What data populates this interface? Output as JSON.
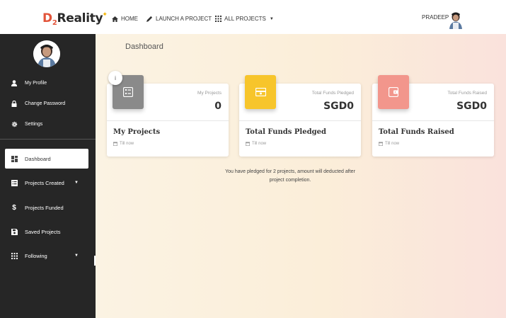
{
  "brand": {
    "logo_d": "D",
    "logo_sub": "2",
    "logo_rest": "Reality",
    "accent": "#e2543a"
  },
  "nav": {
    "home": "HOME",
    "launch": "LAUNCH A PROJECT",
    "all_projects": "ALL PROJECTS",
    "user": "PRADEEP"
  },
  "sidebar": {
    "profile_items": [
      {
        "label": "My Profile",
        "icon": "user-icon"
      },
      {
        "label": "Change Password",
        "icon": "lock-icon"
      },
      {
        "label": "Settings",
        "icon": "gear-icon"
      }
    ],
    "menu_items": [
      {
        "label": "Dashboard",
        "icon": "dashboard-icon",
        "active": true
      },
      {
        "label": "Projects Created",
        "icon": "list-icon",
        "has_dropdown": true
      },
      {
        "label": "Projects Funded",
        "icon": "dollar-icon"
      },
      {
        "label": "Saved Projects",
        "icon": "save-icon"
      },
      {
        "label": "Following",
        "icon": "grid-icon",
        "has_dropdown": true
      }
    ]
  },
  "main": {
    "title": "Dashboard",
    "cards": [
      {
        "caption": "My Projects",
        "value": "0",
        "title": "My Projects",
        "footer": "Till now",
        "color": "#8a8a8a",
        "icon": "checklist-icon"
      },
      {
        "caption": "Total Funds Pledged",
        "value": "SGD0",
        "title": "Total Funds Pledged",
        "footer": "Till now",
        "color": "#f7c52b",
        "icon": "money-icon"
      },
      {
        "caption": "Total Funds Raised",
        "value": "SGD0",
        "title": "Total Funds Raised",
        "footer": "Till now",
        "color": "#f2968c",
        "icon": "wallet-icon"
      }
    ],
    "info_glyph": "i",
    "note": "You have pledged for 2 projects, amount will deducted after project completion."
  }
}
